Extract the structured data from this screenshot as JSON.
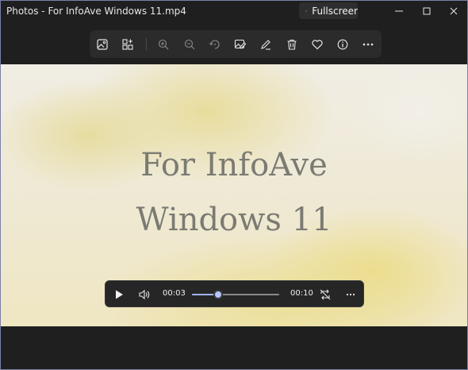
{
  "window": {
    "title": "Photos - For InfoAve Windows 11.mp4"
  },
  "fullscreen_button": {
    "label": "Fullscreer",
    "icon": "expand-icon"
  },
  "window_controls": [
    "minimize-icon",
    "maximize-icon",
    "close-icon"
  ],
  "toolbar": {
    "left_icons": [
      "image-view-icon",
      "add-to-album-icon"
    ],
    "right_icons": [
      "zoom-in-icon",
      "zoom-out-icon",
      "rotate-icon",
      "edit-image-icon",
      "draw-icon",
      "delete-icon",
      "favorite-icon",
      "info-icon",
      "more-icon"
    ]
  },
  "video": {
    "text_line1": "For InfoAve",
    "text_line2": "Windows 11"
  },
  "player": {
    "current_time": "00:03",
    "total_time": "00:10",
    "progress": 0.3,
    "icons": [
      "play-icon",
      "volume-icon",
      "repeat-off-icon",
      "more-options-icon"
    ]
  },
  "colors": {
    "accent": "#9fb4ff",
    "background": "#1f1f1f"
  }
}
